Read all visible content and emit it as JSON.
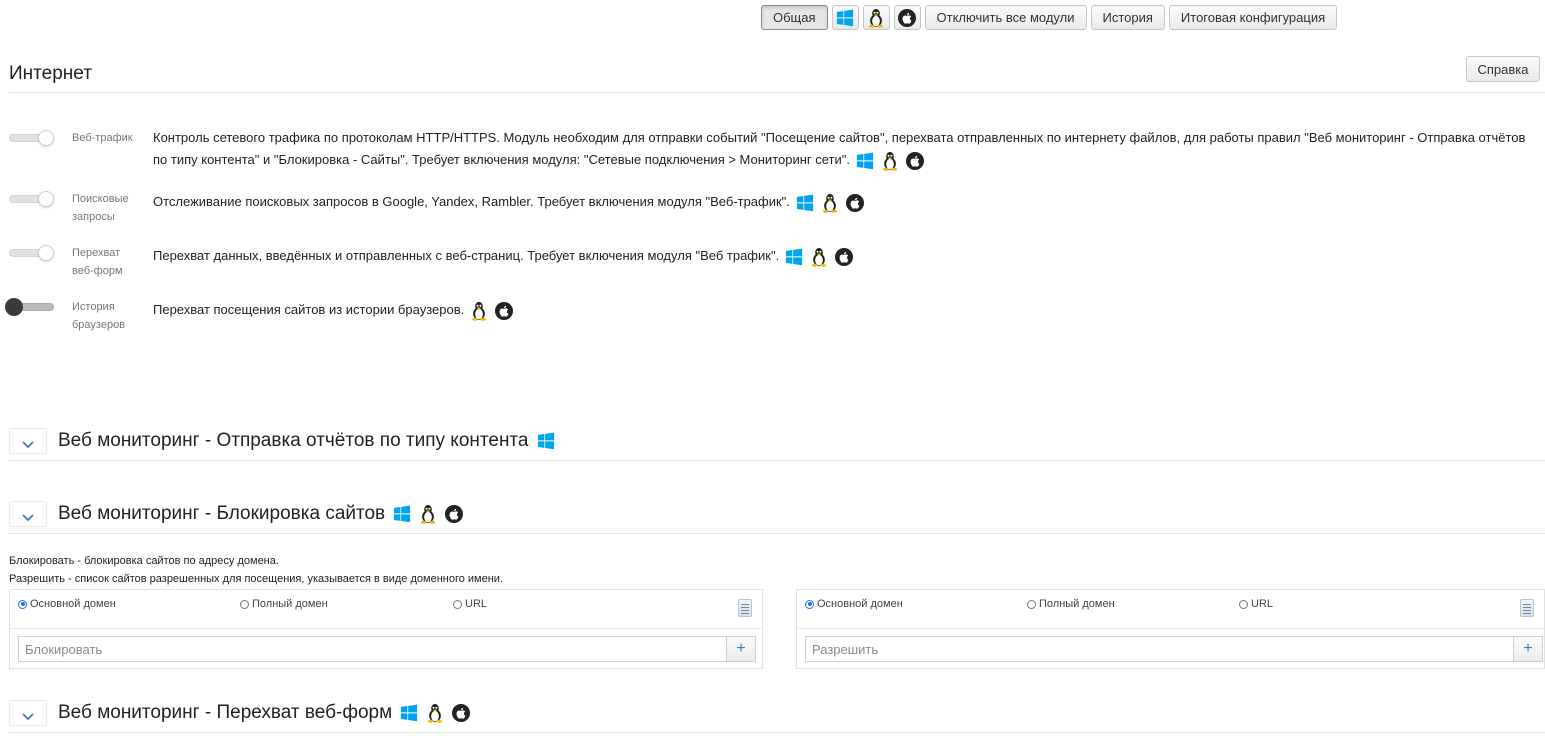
{
  "toolbar": {
    "general": "Общая",
    "disable_all": "Отключить все модули",
    "history": "История",
    "final_config": "Итоговая конфигурация"
  },
  "section": {
    "title": "Интернет",
    "help": "Справка"
  },
  "modules": [
    {
      "label": "Веб-трафик",
      "enabled": true,
      "desc": "Контроль сетевого трафика по протоколам HTTP/HTTPS. Модуль необходим для отправки событий \"Посещение сайтов\", перехвата отправленных по интернету файлов, для работы правил \"Веб мониторинг - Отправка отчётов по типу контента\" и \"Блокировка - Сайты\". Требует включения модуля: \"Сетевые подключения > Мониторинг сети\"."
    },
    {
      "label": "Поисковые запросы",
      "enabled": true,
      "desc": "Отслеживание поисковых запросов в Google, Yandex, Rambler. Требует включения модуля \"Веб-трафик\"."
    },
    {
      "label": "Перехват веб-форм",
      "enabled": true,
      "desc": "Перехват данных, введённых и отправленных с веб-страниц. Требует включения модуля \"Веб трафик\"."
    },
    {
      "label": "История браузеров",
      "enabled": false,
      "desc": "Перехват посещения сайтов из истории браузеров."
    }
  ],
  "rules": {
    "content_reports": "Веб мониторинг - Отправка отчётов по типу контента",
    "site_blocking": "Веб мониторинг - Блокировка сайтов",
    "form_capture": "Веб мониторинг - Перехват веб-форм"
  },
  "blocking": {
    "note_block": "Блокировать - блокировка сайтов по адресу домена.",
    "note_allow": "Разрешить - список сайтов разрешенных для посещения, указывается в виде доменного имени.",
    "radio_main": "Основной домен",
    "radio_full": "Полный домен",
    "radio_url": "URL",
    "block_placeholder": "Блокировать",
    "allow_placeholder": "Разрешить",
    "add": "+"
  },
  "colors": {
    "windows": "#00a4ef",
    "accent": "#3b7bbf"
  }
}
